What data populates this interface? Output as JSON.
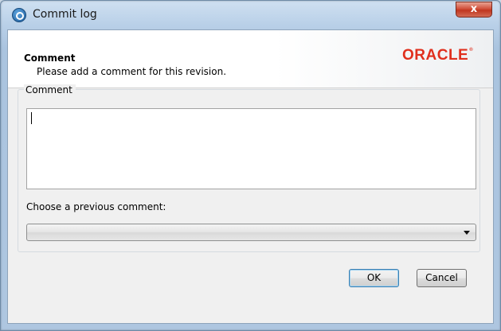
{
  "window": {
    "title": "Commit log",
    "close_label": "x"
  },
  "header": {
    "title": "Comment",
    "subtitle": "Please add a comment for this revision.",
    "logo_text": "ORACLE",
    "logo_mark": "®"
  },
  "comment_group": {
    "legend": "Comment",
    "comment_value": ""
  },
  "previous_comment": {
    "label": "Choose a previous comment:",
    "selected_value": ""
  },
  "buttons": {
    "ok_label": "OK",
    "cancel_label": "Cancel"
  },
  "colors": {
    "oracle_red": "#e0301e",
    "close_red": "#c0361f",
    "titlebar_blue": "#b9d0e8"
  }
}
